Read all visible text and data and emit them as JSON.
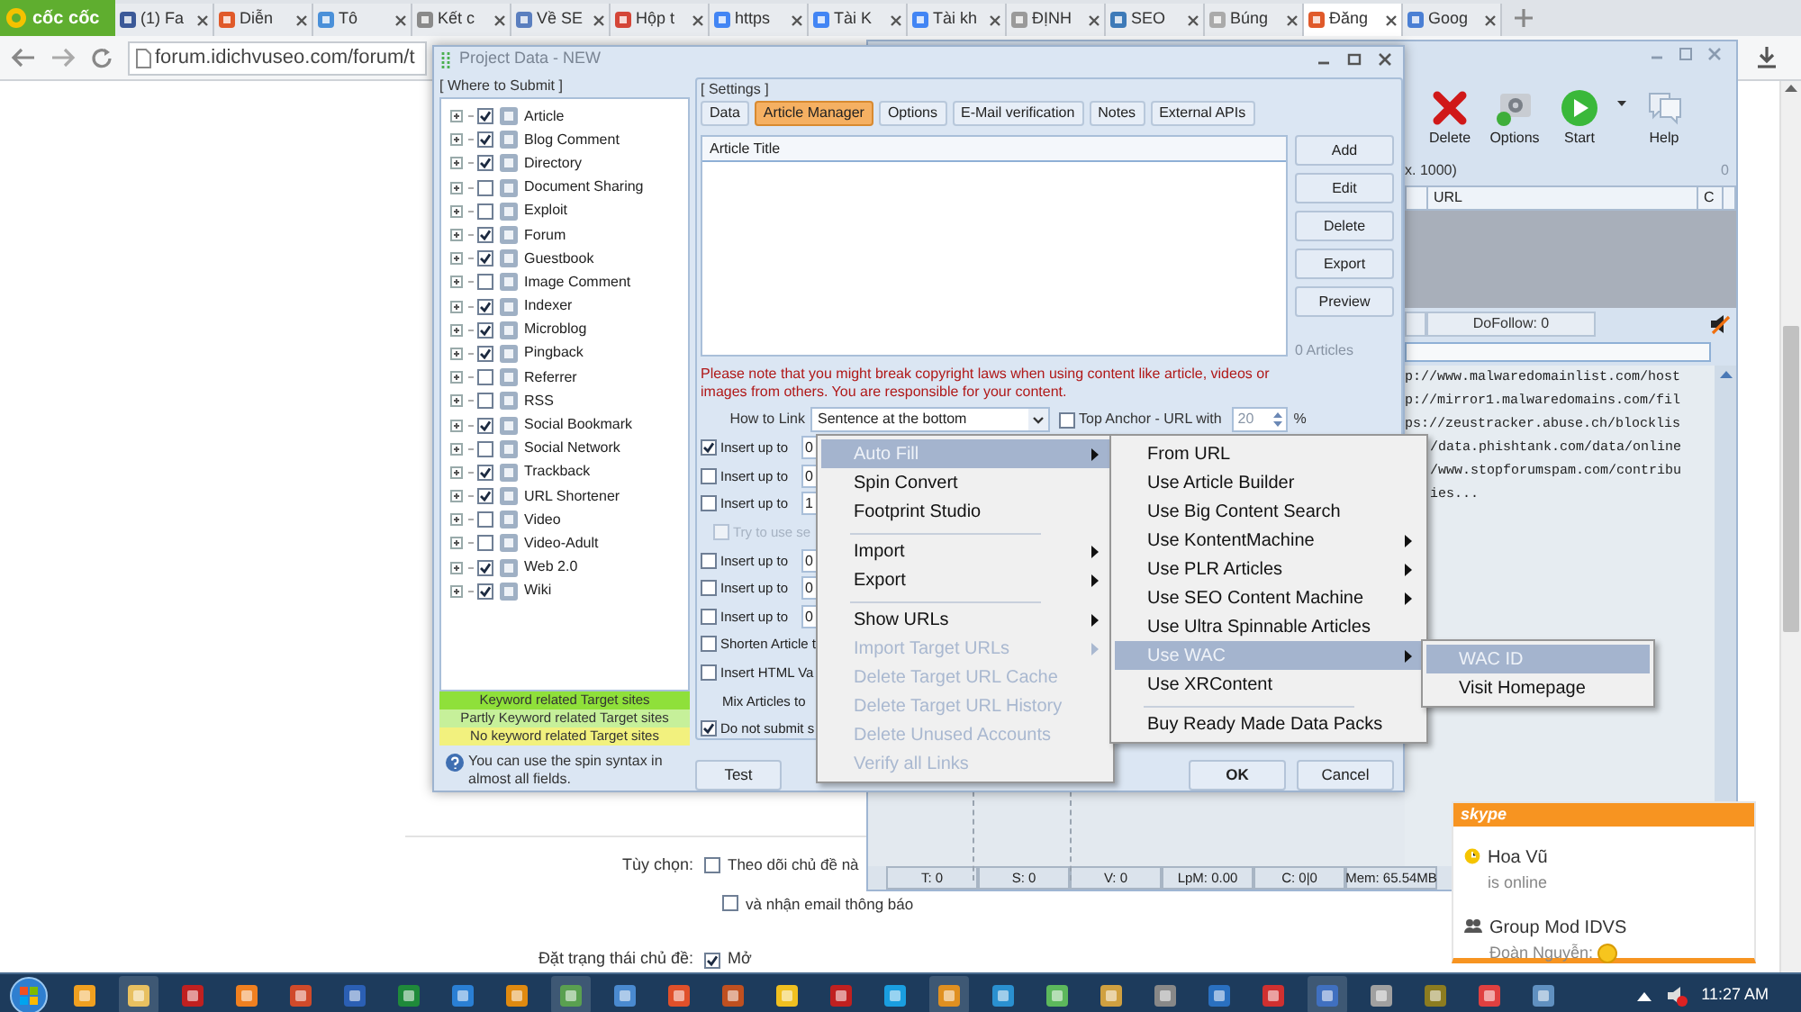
{
  "browser": {
    "logo": "cốc cốc",
    "tabs": [
      {
        "label": "(1) Fa",
        "selected": false
      },
      {
        "label": "Diễn",
        "selected": false
      },
      {
        "label": "Tô",
        "selected": false
      },
      {
        "label": "Kết c",
        "selected": false
      },
      {
        "label": "Về SE",
        "selected": false
      },
      {
        "label": "Hộp t",
        "selected": false
      },
      {
        "label": "https",
        "selected": false
      },
      {
        "label": "Tài K",
        "selected": false
      },
      {
        "label": "Tài kh",
        "selected": false
      },
      {
        "label": "ĐỊNH",
        "selected": false
      },
      {
        "label": "SEO",
        "selected": false
      },
      {
        "label": "Búng",
        "selected": false
      },
      {
        "label": "Đăng",
        "selected": true
      },
      {
        "label": "Goog",
        "selected": false
      }
    ],
    "address": "forum.idichvuseo.com/forum/t"
  },
  "page": {
    "options_label": "Tùy chọn:",
    "options": [
      {
        "label": "Theo dõi chủ đề nà",
        "checked": false
      },
      {
        "label": "và nhận email thông báo",
        "checked": false
      }
    ],
    "status_label": "Đặt trạng thái chủ đề:",
    "status_option": {
      "label": "Mở",
      "checked": true
    }
  },
  "back_app": {
    "toolbar": [
      "Delete",
      "Options",
      "Start",
      "Help"
    ],
    "count_label": "x. 1000)",
    "count": "0",
    "columns": [
      "URL",
      "C"
    ],
    "dofollow": "DoFollow: 0",
    "log": [
      "p://www.malwaredomainlist.com/host",
      "p://mirror1.malwaredomains.com/fil",
      "ps://zeustracker.abuse.ch/blocklis",
      "/data.phishtank.com/data/online",
      "/www.stopforumspam.com/contribu",
      "ies..."
    ],
    "status_bar": [
      "T: 0",
      "S: 0",
      "V: 0",
      "LpM: 0.00",
      "C: 0|0",
      "Mem: 65.54MB"
    ]
  },
  "dialog": {
    "title": "Project Data - NEW",
    "where_legend": "[ Where to Submit ]",
    "targets": [
      {
        "label": "Article",
        "checked": true
      },
      {
        "label": "Blog Comment",
        "checked": true
      },
      {
        "label": "Directory",
        "checked": true
      },
      {
        "label": "Document Sharing",
        "checked": false
      },
      {
        "label": "Exploit",
        "checked": false
      },
      {
        "label": "Forum",
        "checked": true
      },
      {
        "label": "Guestbook",
        "checked": true
      },
      {
        "label": "Image Comment",
        "checked": false
      },
      {
        "label": "Indexer",
        "checked": true
      },
      {
        "label": "Microblog",
        "checked": true
      },
      {
        "label": "Pingback",
        "checked": true
      },
      {
        "label": "Referrer",
        "checked": false
      },
      {
        "label": "RSS",
        "checked": false
      },
      {
        "label": "Social Bookmark",
        "checked": true
      },
      {
        "label": "Social Network",
        "checked": false
      },
      {
        "label": "Trackback",
        "checked": true
      },
      {
        "label": "URL Shortener",
        "checked": true
      },
      {
        "label": "Video",
        "checked": false
      },
      {
        "label": "Video-Adult",
        "checked": false
      },
      {
        "label": "Web 2.0",
        "checked": true
      },
      {
        "label": "Wiki",
        "checked": true
      }
    ],
    "legend": [
      {
        "label": "Keyword related Target sites",
        "color": "#8fe03a"
      },
      {
        "label": "Partly Keyword related Target sites",
        "color": "#c6f09a"
      },
      {
        "label": "No keyword related Target sites",
        "color": "#f2f17e"
      }
    ],
    "hint": "You can use the spin syntax in almost all fields.",
    "settings_legend": "[ Settings ]",
    "tabs": [
      {
        "label": "Data",
        "selected": false
      },
      {
        "label": "Article Manager",
        "selected": true
      },
      {
        "label": "Options",
        "selected": false
      },
      {
        "label": "E-Mail verification",
        "selected": false
      },
      {
        "label": "Notes",
        "selected": false
      },
      {
        "label": "External APIs",
        "selected": false
      }
    ],
    "article_column": "Article Title",
    "side_buttons": [
      "Add",
      "Edit",
      "Delete",
      "Export",
      "Preview"
    ],
    "article_count": "0 Articles",
    "warning": "Please note that you might break copyright laws when using content like article, videos or images from others. You are responsible for your content.",
    "how_to_link": {
      "label": "How to Link",
      "value": "Sentence at the bottom"
    },
    "top_anchor": {
      "label": "Top Anchor - URL with",
      "checked": false,
      "value": "20",
      "unit": "%"
    },
    "options": [
      {
        "kind": "insert",
        "label": "Insert up to",
        "checked": true,
        "disabled": false,
        "value": "0"
      },
      {
        "kind": "insert",
        "label": "Insert up to",
        "checked": false,
        "disabled": false,
        "value": "0"
      },
      {
        "kind": "insert",
        "label": "Insert up to",
        "checked": false,
        "disabled": false,
        "value": "1",
        "children": [
          {
            "kind": "check",
            "label": "Try to use se",
            "checked": false,
            "disabled": true
          }
        ]
      },
      {
        "kind": "insert",
        "label": "Insert up to",
        "checked": false,
        "disabled": false,
        "value": "0"
      },
      {
        "kind": "insert",
        "label": "Insert up to",
        "checked": false,
        "disabled": false,
        "value": "0"
      },
      {
        "kind": "insert",
        "label": "Insert up to",
        "checked": false,
        "disabled": false,
        "value": "0"
      },
      {
        "kind": "check",
        "label": "Shorten Article t",
        "checked": false,
        "disabled": false
      },
      {
        "kind": "check",
        "label": "Insert HTML Va",
        "checked": false,
        "disabled": false
      },
      {
        "kind": "text",
        "label": "Mix Articles to"
      },
      {
        "kind": "check",
        "label": "Do not submit s",
        "checked": true,
        "disabled": false
      }
    ],
    "buttons": [
      "Test",
      "OK",
      "Cancel"
    ]
  },
  "context_menu": {
    "items": [
      {
        "kind": "item",
        "label": "Auto Fill",
        "submenu": true,
        "disabled": false,
        "selected": true
      },
      {
        "kind": "item",
        "label": "Spin Convert",
        "submenu": false,
        "disabled": false,
        "selected": false
      },
      {
        "kind": "item",
        "label": "Footprint Studio",
        "submenu": false,
        "disabled": false,
        "selected": false
      },
      {
        "kind": "separator"
      },
      {
        "kind": "item",
        "label": "Import",
        "submenu": true,
        "disabled": false,
        "selected": false
      },
      {
        "kind": "item",
        "label": "Export",
        "submenu": true,
        "disabled": false,
        "selected": false
      },
      {
        "kind": "separator"
      },
      {
        "kind": "item",
        "label": "Show URLs",
        "submenu": true,
        "disabled": false,
        "selected": false
      },
      {
        "kind": "item",
        "label": "Import Target URLs",
        "submenu": true,
        "disabled": true,
        "selected": false
      },
      {
        "kind": "item",
        "label": "Delete Target URL Cache",
        "submenu": false,
        "disabled": true,
        "selected": false
      },
      {
        "kind": "item",
        "label": "Delete Target URL History",
        "submenu": false,
        "disabled": true,
        "selected": false
      },
      {
        "kind": "item",
        "label": "Delete Unused Accounts",
        "submenu": false,
        "disabled": true,
        "selected": false
      },
      {
        "kind": "item",
        "label": "Verify all Links",
        "submenu": false,
        "disabled": true,
        "selected": false
      }
    ]
  },
  "submenu": {
    "items": [
      {
        "kind": "item",
        "label": "From URL",
        "submenu": false,
        "selected": false
      },
      {
        "kind": "item",
        "label": "Use Article Builder",
        "submenu": false,
        "selected": false
      },
      {
        "kind": "item",
        "label": "Use Big Content Search",
        "submenu": false,
        "selected": false
      },
      {
        "kind": "item",
        "label": "Use KontentMachine",
        "submenu": true,
        "selected": false
      },
      {
        "kind": "item",
        "label": "Use PLR Articles",
        "submenu": true,
        "selected": false
      },
      {
        "kind": "item",
        "label": "Use SEO Content Machine",
        "submenu": true,
        "selected": false
      },
      {
        "kind": "item",
        "label": "Use Ultra Spinnable Articles",
        "submenu": false,
        "selected": false
      },
      {
        "kind": "item",
        "label": "Use WAC",
        "submenu": true,
        "selected": true
      },
      {
        "kind": "item",
        "label": "Use XRContent",
        "submenu": false,
        "selected": false
      },
      {
        "kind": "separator"
      },
      {
        "kind": "item",
        "label": "Buy Ready Made Data Packs",
        "submenu": false,
        "selected": false
      }
    ]
  },
  "wac_menu": {
    "items": [
      {
        "kind": "item",
        "label": "WAC ID",
        "submenu": false,
        "selected": true
      },
      {
        "kind": "item",
        "label": "Visit Homepage",
        "submenu": false,
        "selected": false
      }
    ]
  },
  "skype": {
    "logo": "skype",
    "contacts": [
      {
        "kind": "person",
        "name": "Hoa Vũ",
        "status": "is online"
      },
      {
        "kind": "group",
        "name": "Group Mod IDVS",
        "status": "Đoàn Nguyễn:"
      }
    ]
  },
  "taskbar": {
    "clock": "11:27 AM"
  }
}
